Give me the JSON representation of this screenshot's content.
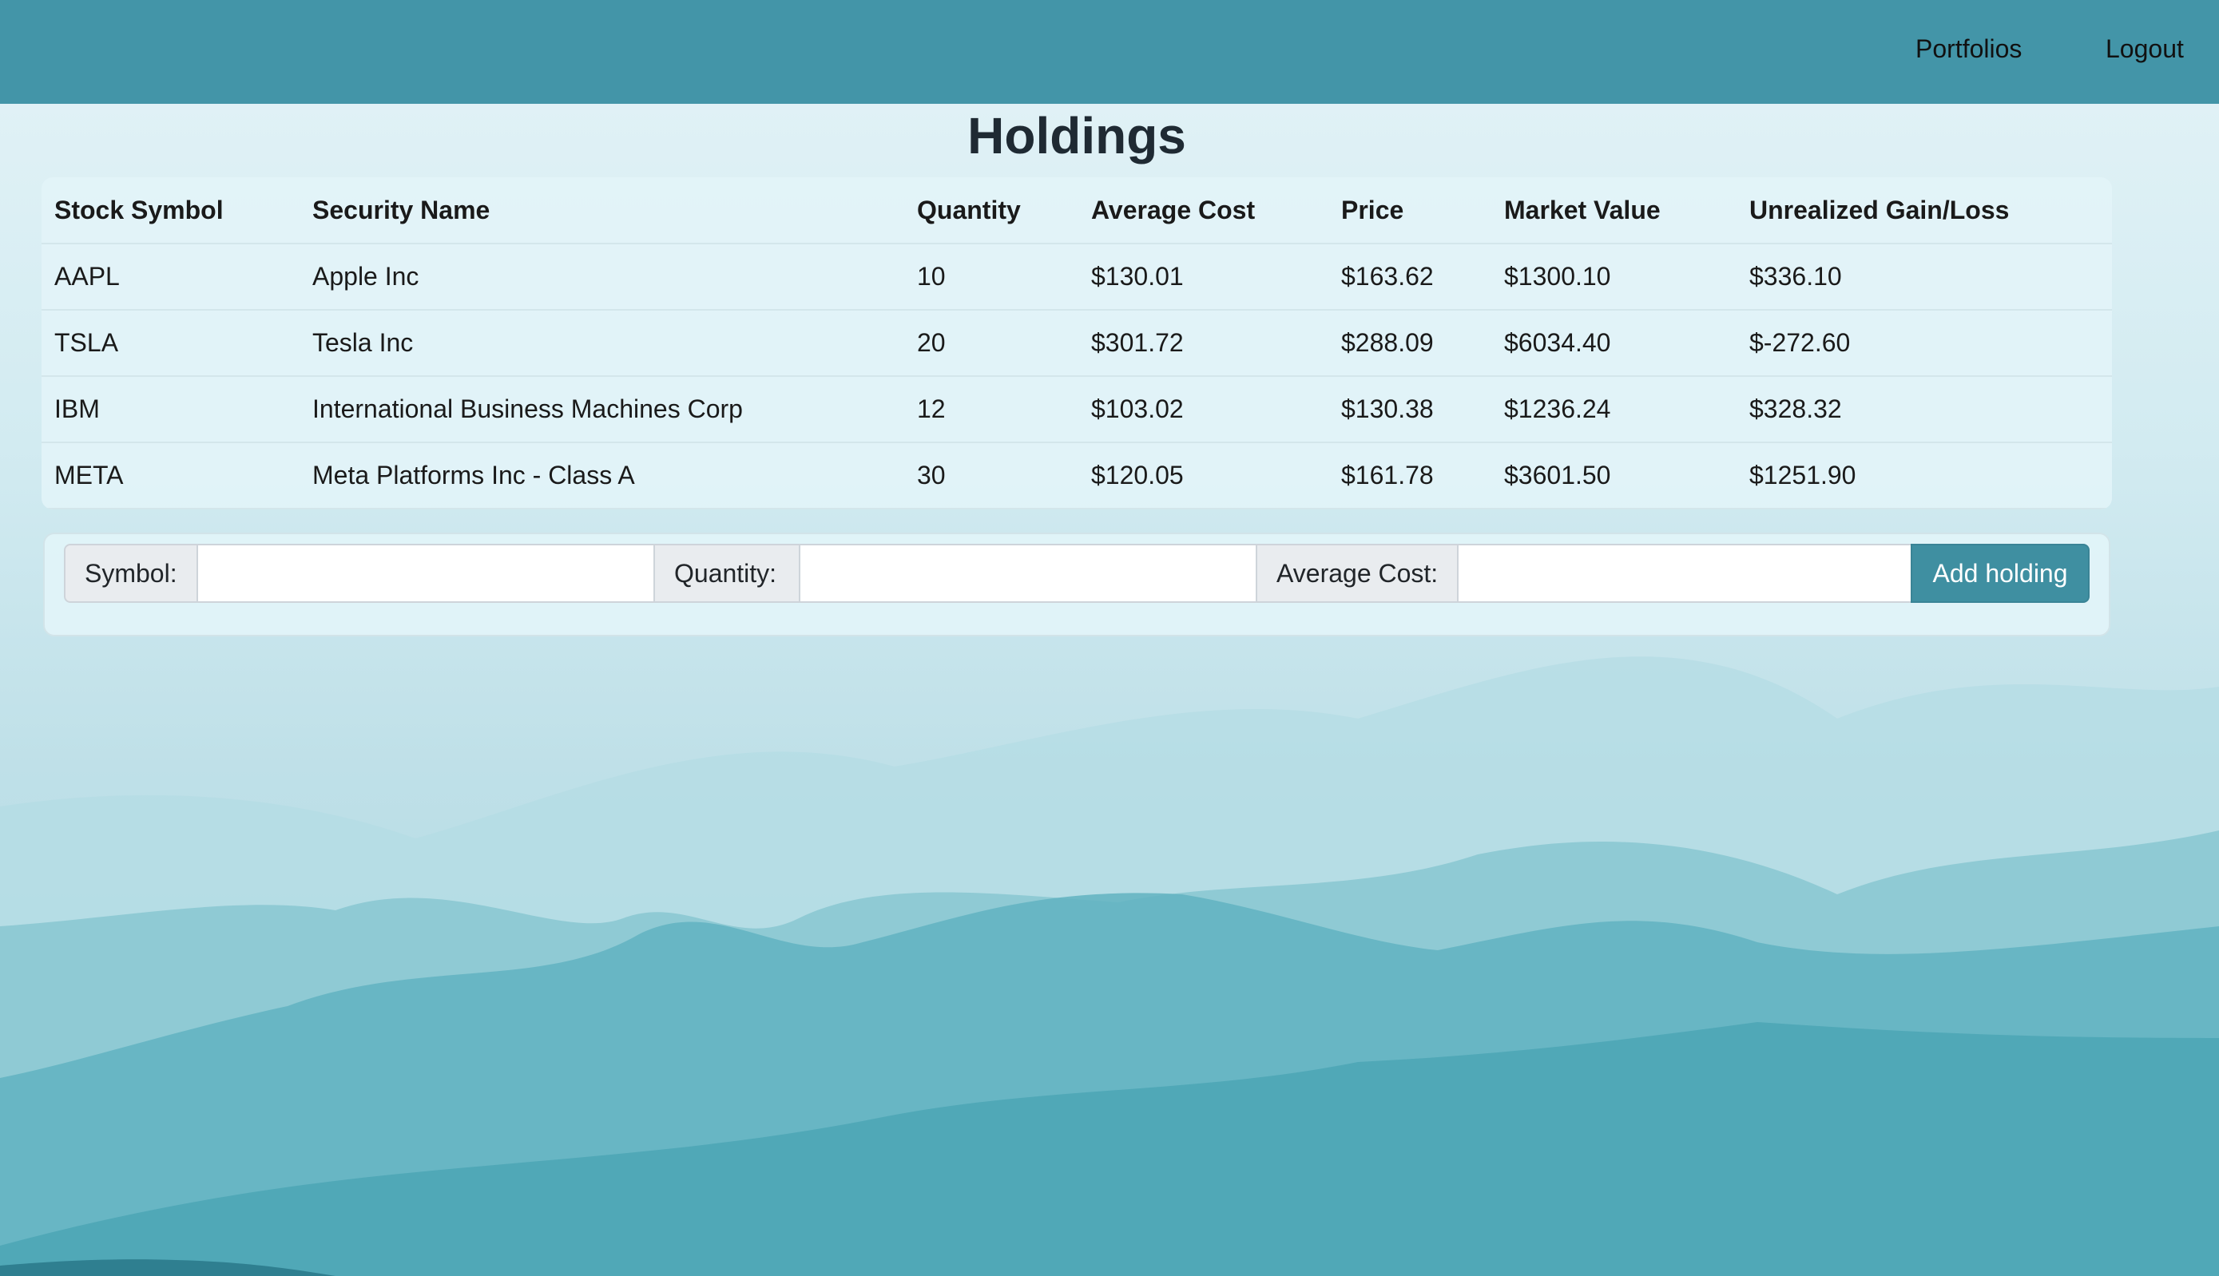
{
  "nav": {
    "portfolios": "Portfolios",
    "logout": "Logout"
  },
  "page": {
    "title": "Holdings"
  },
  "table": {
    "headers": [
      "Stock Symbol",
      "Security Name",
      "Quantity",
      "Average Cost",
      "Price",
      "Market Value",
      "Unrealized Gain/Loss"
    ],
    "rows": [
      [
        "AAPL",
        "Apple Inc",
        "10",
        "$130.01",
        "$163.62",
        "$1300.10",
        "$336.10"
      ],
      [
        "TSLA",
        "Tesla Inc",
        "20",
        "$301.72",
        "$288.09",
        "$6034.40",
        "$-272.60"
      ],
      [
        "IBM",
        "International Business Machines Corp",
        "12",
        "$103.02",
        "$130.38",
        "$1236.24",
        "$328.32"
      ],
      [
        "META",
        "Meta Platforms Inc - Class A",
        "30",
        "$120.05",
        "$161.78",
        "$3601.50",
        "$1251.90"
      ]
    ]
  },
  "form": {
    "symbol_label": "Symbol:",
    "symbol_value": "",
    "quantity_label": "Quantity:",
    "quantity_value": "",
    "cost_label": "Average Cost:",
    "cost_value": "",
    "submit_label": "Add holding"
  },
  "colors": {
    "navbar": "#4395a8",
    "button": "#3f8fa1"
  }
}
